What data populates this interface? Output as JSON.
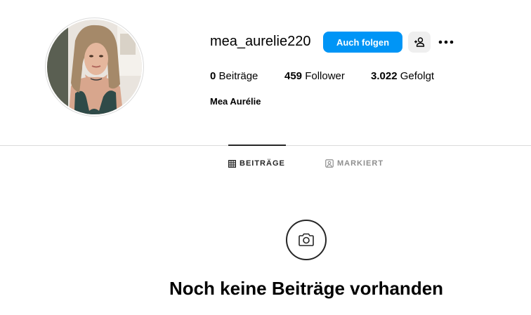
{
  "profile": {
    "username": "mea_aurelie220",
    "full_name": "Mea Aurélie",
    "avatar_icon": "profile-photo",
    "actions": {
      "follow_label": "Auch folgen",
      "suggest_icon": "person-add-icon",
      "more_icon": "more-options-icon"
    },
    "stats": [
      {
        "count": "0",
        "label": "Beiträge"
      },
      {
        "count": "459",
        "label": "Follower"
      },
      {
        "count": "3.022",
        "label": "Gefolgt"
      }
    ]
  },
  "tabs": [
    {
      "label": "BEITRÄGE",
      "icon": "grid-icon",
      "active": true
    },
    {
      "label": "MARKIERT",
      "icon": "tagged-icon",
      "active": false
    }
  ],
  "empty_state": {
    "icon": "camera-icon",
    "title": "Noch keine Beiträge vorhanden"
  },
  "colors": {
    "accent": "#0095f6",
    "secondary_button": "#efefef",
    "divider": "#dbdbdb",
    "muted_text": "#8e8e8e",
    "dark": "#262626"
  }
}
